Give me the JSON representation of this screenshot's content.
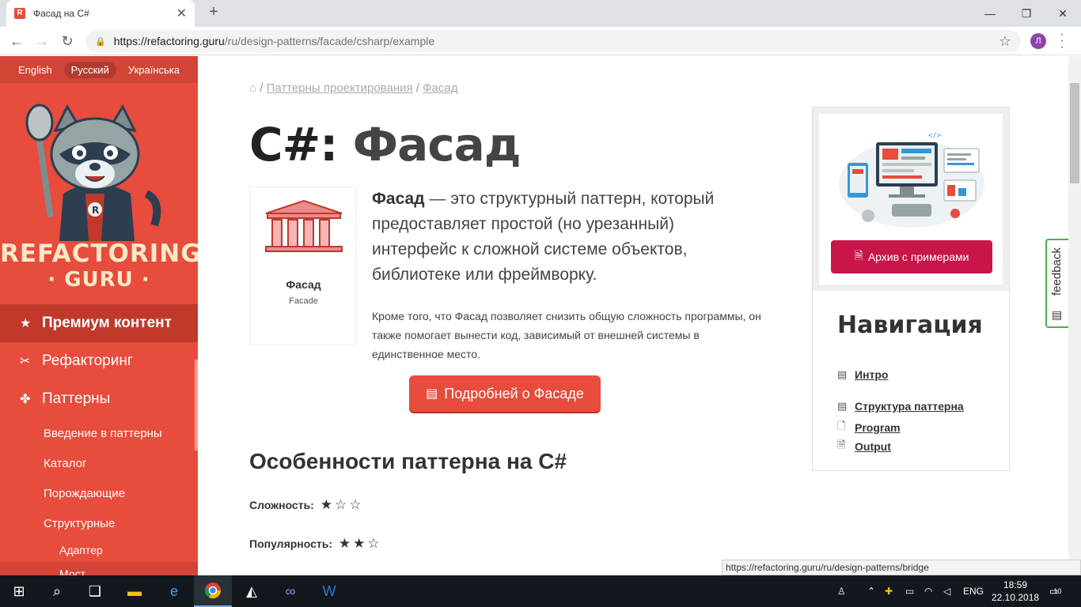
{
  "browser": {
    "tab_title": "Фасад на C#",
    "favicon_letter": "R",
    "url_host": "https://refactoring.guru",
    "url_path": "/ru/design-patterns/facade/csharp/example",
    "profile_letter": "Л",
    "status_url": "https://refactoring.guru/ru/design-patterns/bridge"
  },
  "sidebar": {
    "languages": [
      {
        "label": "English",
        "active": false
      },
      {
        "label": "Русский",
        "active": true
      },
      {
        "label": "Українська",
        "active": false
      }
    ],
    "logo_line1": "REFACTORING",
    "logo_line2": "· GURU ·",
    "menu": [
      {
        "label": "Премиум контент",
        "icon": "star-icon"
      },
      {
        "label": "Рефакторинг",
        "icon": "scissors-icon"
      },
      {
        "label": "Паттерны",
        "icon": "puzzle-icon"
      }
    ],
    "submenu": [
      "Введение в паттерны",
      "Каталог",
      "Порождающие",
      "Структурные"
    ],
    "subsubmenu": [
      "Адаптер",
      "Мост"
    ]
  },
  "main": {
    "breadcrumb": {
      "home_icon": "home-icon",
      "sep": " / ",
      "item1": "Паттерны проектирования",
      "item2": "Фасад"
    },
    "title_lang": "C#:",
    "title_name": "Фасад",
    "card_name": "Фасад",
    "card_sub": "Facade",
    "lead_bold": "Фасад",
    "lead_rest": " — это структурный паттерн, который предоставляет простой (но урезанный) интерфейс к сложной системе объектов, библиотеке или фреймворку.",
    "intro2": "Кроме того, что Фасад позволяет снизить общую сложность программы, он также помогает вынести код, зависимый от внешней системы в единственное место.",
    "more_button": "Подробней о Фасаде",
    "features_title": "Особенности паттерна на C#",
    "complexity_label": "Сложность:",
    "complexity_stars": 1,
    "popularity_label": "Популярность:",
    "popularity_stars": 2
  },
  "right_panel": {
    "archive_button": "Архив с примерами",
    "nav_title": "Навигация",
    "nav_links": [
      {
        "label": "Интро",
        "icon": "newspaper-icon"
      },
      {
        "label": "Структура паттерна",
        "icon": "newspaper-icon"
      },
      {
        "label": "Program",
        "icon": "code-file-icon"
      },
      {
        "label": "Output",
        "icon": "text-file-icon"
      }
    ],
    "feedback": "feedback"
  },
  "taskbar": {
    "lang": "ENG",
    "time": "18:59",
    "date": "22.10.2018",
    "notifications": "10"
  },
  "colors": {
    "brand_red": "#e74c3c",
    "sidebar_active": "#c0392b",
    "archive_button": "#c8154a",
    "feedback_border": "#4caf50"
  }
}
